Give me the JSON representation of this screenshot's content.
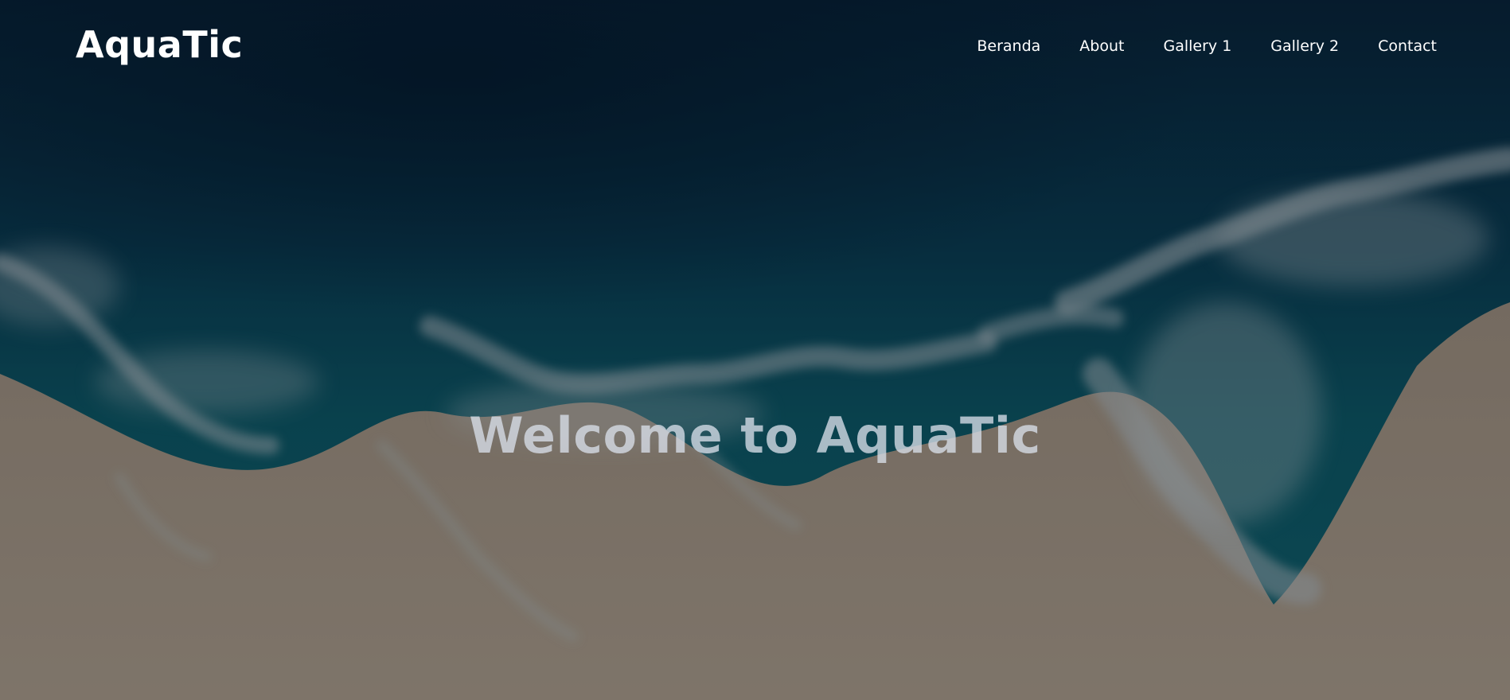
{
  "brand": {
    "name": "AquaTic"
  },
  "nav": {
    "items": [
      {
        "label": "Beranda"
      },
      {
        "label": "About"
      },
      {
        "label": "Gallery 1"
      },
      {
        "label": "Gallery 2"
      },
      {
        "label": "Contact"
      }
    ]
  },
  "hero": {
    "title": "Welcome to AquaTic",
    "background_image": "aerial-ocean-beach-photo",
    "colors": {
      "deep_water": "#0a2f4a",
      "shallow_water": "#0f5a6e",
      "foam": "#b7c9d4",
      "sand": "#a89c8e",
      "text": "#ffffff"
    }
  }
}
